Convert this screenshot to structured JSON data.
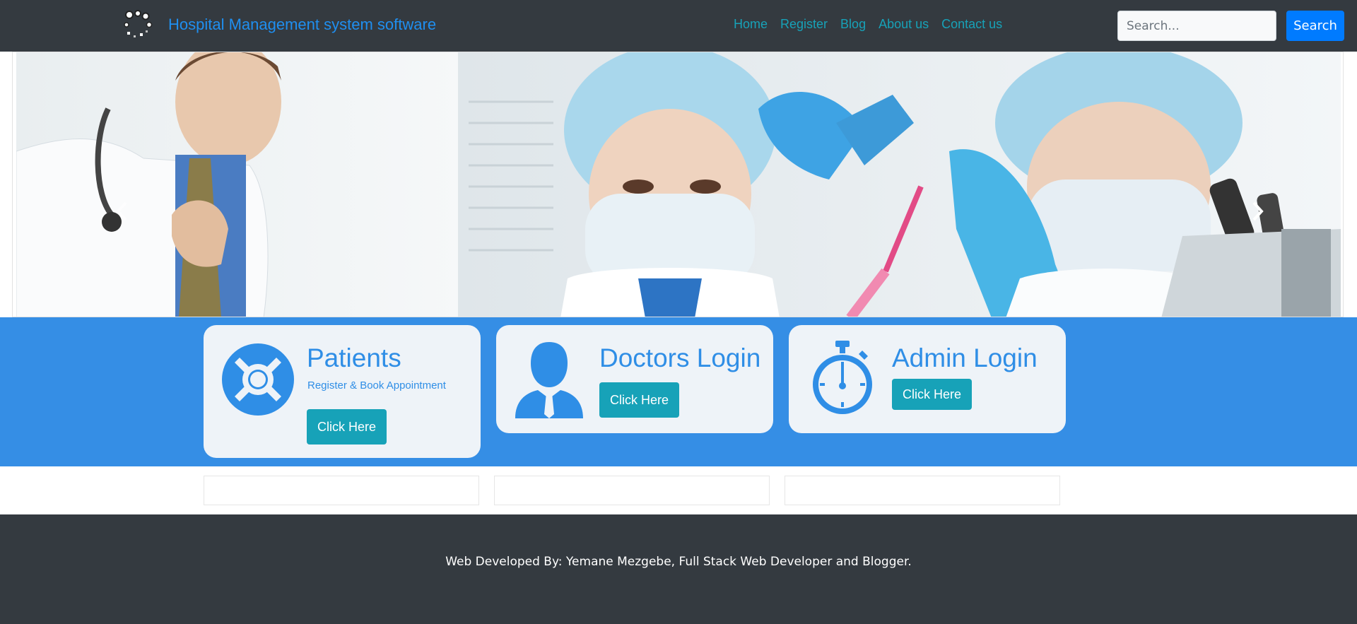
{
  "navbar": {
    "brand_text": "Hospital Management system software",
    "links": [
      {
        "label": "Home"
      },
      {
        "label": "Register"
      },
      {
        "label": "Blog"
      },
      {
        "label": "About us"
      },
      {
        "label": "Contact us"
      }
    ],
    "search_placeholder": "Search...",
    "search_button_label": "Search"
  },
  "carousel": {
    "prev_icon": "chevron-left-icon",
    "next_icon": "chevron-right-icon"
  },
  "cards": [
    {
      "title": "Patients",
      "subtitle": "Register & Book Appointment",
      "button_label": "Click Here",
      "icon": "lifebuoy-icon"
    },
    {
      "title": "Doctors Login",
      "button_label": "Click Here",
      "icon": "doctor-icon"
    },
    {
      "title": "Admin Login",
      "button_label": "Click Here",
      "icon": "stopwatch-icon"
    }
  ],
  "footer": {
    "text": "Web Developed By: Yemane Mezgebe, Full Stack Web Developer and Blogger."
  },
  "colors": {
    "navbar_bg": "#343a40",
    "brand": "#1f8ff0",
    "nav_link": "#17a2b8",
    "search_button": "#007bff",
    "band": "#358ee5",
    "card_bg": "#eef3f8",
    "card_accent": "#2f8ee6",
    "card_button": "#17a2b8"
  }
}
